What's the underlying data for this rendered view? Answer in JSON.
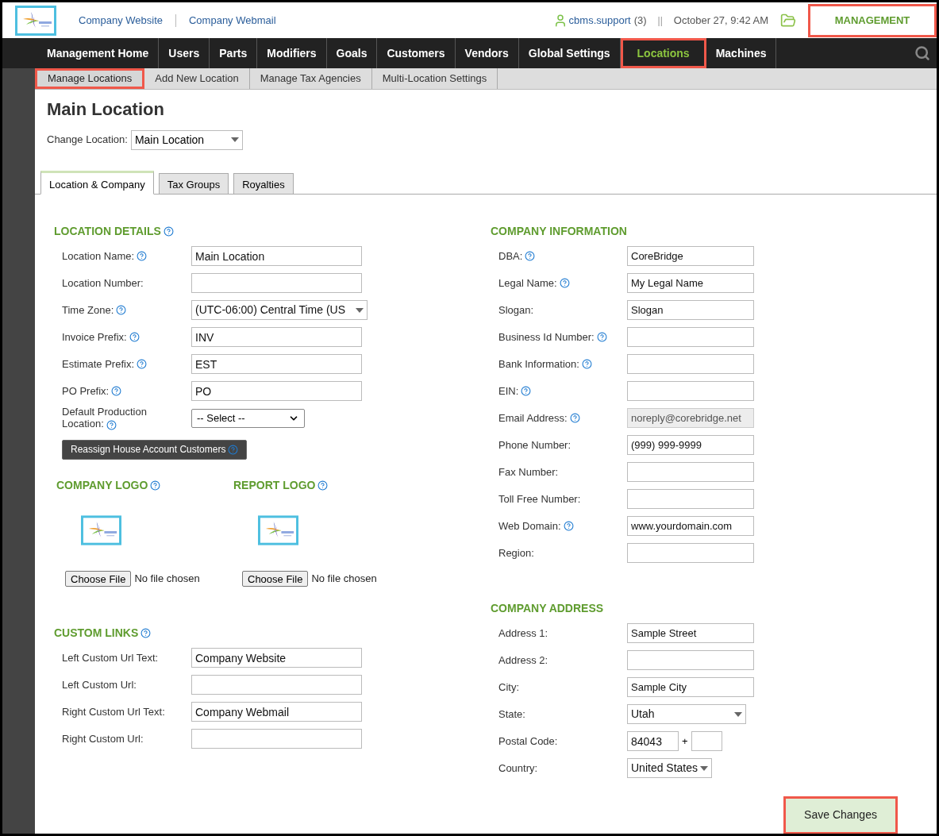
{
  "header": {
    "links": [
      {
        "label": "Company Website"
      },
      {
        "label": "Company Webmail"
      }
    ],
    "user": "cbms.support",
    "user_count": "(3)",
    "separator": "||",
    "datetime": "October 27, 9:42 AM",
    "module": {
      "label": "MANAGEMENT",
      "highlighted": true
    }
  },
  "nav": [
    {
      "label": "Management Home",
      "selected": false,
      "highlighted": false
    },
    {
      "label": "Users",
      "selected": false,
      "highlighted": false
    },
    {
      "label": "Parts",
      "selected": false,
      "highlighted": false
    },
    {
      "label": "Modifiers",
      "selected": false,
      "highlighted": false
    },
    {
      "label": "Goals",
      "selected": false,
      "highlighted": false
    },
    {
      "label": "Customers",
      "selected": false,
      "highlighted": false
    },
    {
      "label": "Vendors",
      "selected": false,
      "highlighted": false
    },
    {
      "label": "Global Settings",
      "selected": false,
      "highlighted": false
    },
    {
      "label": "Locations",
      "selected": true,
      "highlighted": true
    },
    {
      "label": "Machines",
      "selected": false,
      "highlighted": false
    }
  ],
  "subnav": [
    {
      "label": "Manage Locations",
      "selected": true,
      "highlighted": true
    },
    {
      "label": "Add New Location",
      "selected": false,
      "highlighted": false
    },
    {
      "label": "Manage Tax Agencies",
      "selected": false,
      "highlighted": false
    },
    {
      "label": "Multi-Location Settings",
      "selected": false,
      "highlighted": false
    }
  ],
  "page_title": "Main Location",
  "change_location": {
    "label": "Change Location:",
    "value": "Main Location"
  },
  "tabs": [
    {
      "label": "Location & Company",
      "selected": true
    },
    {
      "label": "Tax Groups",
      "selected": false
    },
    {
      "label": "Royalties",
      "selected": false
    }
  ],
  "location_details": {
    "title": "LOCATION DETAILS",
    "help": true,
    "fields": [
      {
        "label": "Location Name:",
        "help": true,
        "kind": "text",
        "value": "Main Location"
      },
      {
        "label": "Location Number:",
        "help": false,
        "kind": "text"
      },
      {
        "label": "Time Zone:",
        "help": true,
        "kind": "dropdown",
        "value": "(UTC-06:00) Central Time (US"
      },
      {
        "label": "Invoice Prefix:",
        "help": true,
        "kind": "text",
        "value": "INV"
      },
      {
        "label": "Estimate Prefix:",
        "help": true,
        "kind": "text",
        "value": "EST"
      },
      {
        "label": "PO Prefix:",
        "help": true,
        "kind": "text",
        "value": "PO"
      },
      {
        "label": "Default Production Location:",
        "help": true,
        "kind": "native",
        "value": "-- Select --"
      }
    ]
  },
  "reassign_button": {
    "label": "Reassign House Account Customers",
    "help": true
  },
  "logos": [
    {
      "title": "COMPANY LOGO",
      "help": true,
      "button": "Choose File",
      "status": "No file chosen"
    },
    {
      "title": "REPORT LOGO",
      "help": true,
      "button": "Choose File",
      "status": "No file chosen"
    }
  ],
  "custom_links": {
    "title": "CUSTOM LINKS",
    "help": true,
    "fields": [
      {
        "label": "Left Custom Url Text:",
        "help": false,
        "kind": "text",
        "value": "Company Website"
      },
      {
        "label": "Left Custom Url:",
        "help": false,
        "kind": "text"
      },
      {
        "label": "Right Custom Url Text:",
        "help": false,
        "kind": "text",
        "value": "Company Webmail"
      },
      {
        "label": "Right Custom Url:",
        "help": false,
        "kind": "text"
      }
    ]
  },
  "company_information": {
    "title": "COMPANY INFORMATION",
    "help": false,
    "fields": [
      {
        "label": "DBA:",
        "help": true,
        "kind": "text",
        "value": "CoreBridge",
        "disabled": false
      },
      {
        "label": "Legal Name:",
        "help": true,
        "kind": "text",
        "value": "My Legal Name",
        "disabled": false
      },
      {
        "label": "Slogan:",
        "help": false,
        "kind": "text",
        "value": "Slogan",
        "disabled": false
      },
      {
        "label": "Business Id Number:",
        "help": true,
        "kind": "text",
        "disabled": false
      },
      {
        "label": "Bank Information:",
        "help": true,
        "kind": "text",
        "disabled": false
      },
      {
        "label": "EIN:",
        "help": true,
        "kind": "text",
        "disabled": false
      },
      {
        "label": "Email Address:",
        "help": true,
        "kind": "text",
        "value": "noreply@corebridge.net",
        "disabled": true
      },
      {
        "label": "Phone Number:",
        "help": false,
        "kind": "text",
        "value": "(999) 999-9999",
        "disabled": false
      },
      {
        "label": "Fax Number:",
        "help": false,
        "kind": "text",
        "disabled": false
      },
      {
        "label": "Toll Free Number:",
        "help": false,
        "kind": "text",
        "disabled": false
      },
      {
        "label": "Web Domain:",
        "help": true,
        "kind": "text",
        "value": "www.yourdomain.com",
        "disabled": false
      },
      {
        "label": "Region:",
        "help": false,
        "kind": "text",
        "disabled": false
      }
    ]
  },
  "company_address": {
    "title": "COMPANY ADDRESS",
    "help": false,
    "fields": [
      {
        "label": "Address 1:",
        "help": false,
        "kind": "text",
        "value": "Sample Street"
      },
      {
        "label": "Address 2:",
        "help": false,
        "kind": "text"
      },
      {
        "label": "City:",
        "help": false,
        "kind": "text",
        "value": "Sample City"
      },
      {
        "label": "State:",
        "help": false,
        "kind": "state",
        "value": "Utah"
      },
      {
        "label": "Postal Code:",
        "help": false,
        "kind": "postal",
        "value": "84043",
        "separator": "+"
      },
      {
        "label": "Country:",
        "help": false,
        "kind": "country",
        "value": "United States"
      }
    ]
  },
  "save_button": {
    "label": "Save Changes",
    "highlighted": true
  }
}
